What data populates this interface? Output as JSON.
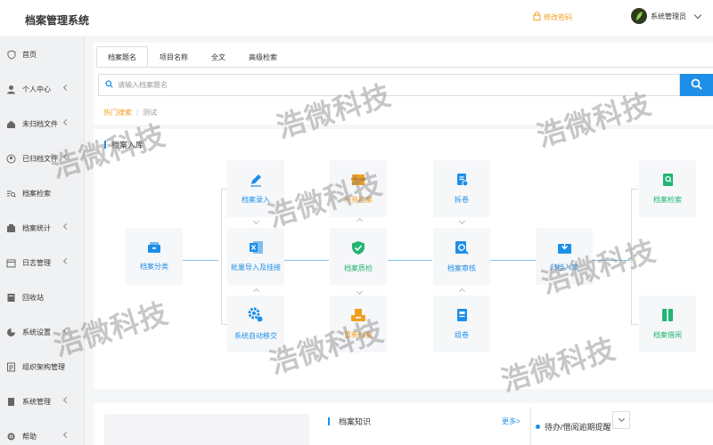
{
  "app": {
    "title": "档案管理系统"
  },
  "header": {
    "change_password": "修改密码",
    "user_name": "系统管理员"
  },
  "sidebar": {
    "items": [
      {
        "label": "首页",
        "icon": "shield-icon",
        "arrow": false
      },
      {
        "label": "个人中心",
        "icon": "person-icon",
        "arrow": true
      },
      {
        "label": "未归档文件",
        "icon": "house-icon",
        "arrow": true
      },
      {
        "label": "已归档文件",
        "icon": "user-circle-icon",
        "arrow": true
      },
      {
        "label": "档案检索",
        "icon": "search-list-icon",
        "arrow": false
      },
      {
        "label": "档案统计",
        "icon": "stats-icon",
        "arrow": true
      },
      {
        "label": "日志管理",
        "icon": "calendar-icon",
        "arrow": true
      },
      {
        "label": "回收站",
        "icon": "recycle-icon",
        "arrow": false
      },
      {
        "label": "系统设置",
        "icon": "pie-icon",
        "arrow": true
      },
      {
        "label": "组织架构管理",
        "icon": "org-icon",
        "arrow": false
      },
      {
        "label": "系统管理",
        "icon": "gear-icon",
        "arrow": true
      },
      {
        "label": "帮助",
        "icon": "help-gear-icon",
        "arrow": true
      }
    ]
  },
  "search": {
    "tabs": [
      "档案题名",
      "项目名称",
      "全文",
      "高级检索"
    ],
    "active_tab": 0,
    "placeholder": "请输入档案题名",
    "hot_label": "热门搜索",
    "hot_sep": "|",
    "hot_keyword": "测试"
  },
  "flow": {
    "title": "档案入库",
    "nodes": {
      "fenlei": "档案分类",
      "luru": "档案录入",
      "piliang": "批量导入及挂接",
      "yijiao": "系统自动移交",
      "buchong": "补充档案",
      "zhijian": "档案质检",
      "zuxie": "重新档案",
      "chaijuan": "拆卷",
      "shenhe": "档案审核",
      "zujuan": "组卷",
      "guidang": "归档入库",
      "jiansuo": "档案检索",
      "jieyue": "档案借阅"
    }
  },
  "knowledge": {
    "title": "档案知识",
    "more": "更多>"
  },
  "todo": {
    "title": "待办/借阅逾期提醒"
  },
  "watermark": "浩微科技",
  "colors": {
    "accent": "#1e8fe8",
    "warning": "#f0a020",
    "success": "#22b573"
  }
}
